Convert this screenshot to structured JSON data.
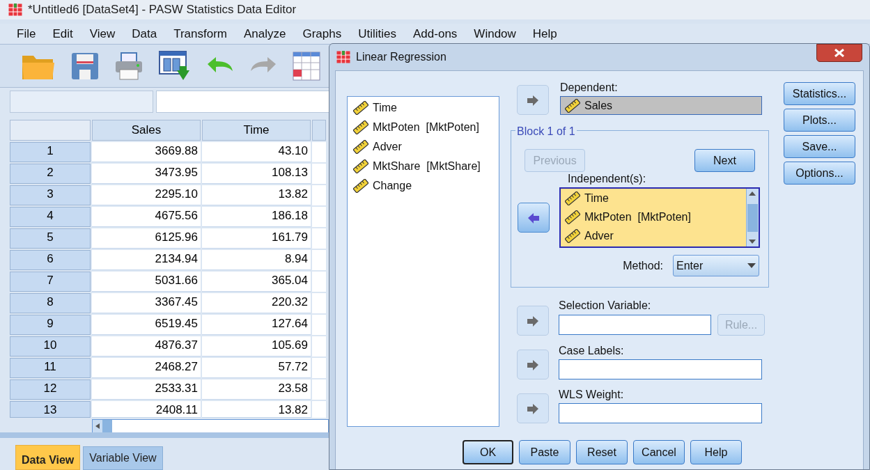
{
  "window": {
    "title": "*Untitled6 [DataSet4] - PASW Statistics Data Editor",
    "menu": [
      "File",
      "Edit",
      "View",
      "Data",
      "Transform",
      "Analyze",
      "Graphs",
      "Utilities",
      "Add-ons",
      "Window",
      "Help"
    ],
    "table": {
      "columns": [
        "Sales",
        "Time"
      ],
      "rows": [
        {
          "row": "1",
          "values": [
            "3669.88",
            "43.10"
          ]
        },
        {
          "row": "2",
          "values": [
            "3473.95",
            "108.13"
          ]
        },
        {
          "row": "3",
          "values": [
            "2295.10",
            "13.82"
          ]
        },
        {
          "row": "4",
          "values": [
            "4675.56",
            "186.18"
          ]
        },
        {
          "row": "5",
          "values": [
            "6125.96",
            "161.79"
          ]
        },
        {
          "row": "6",
          "values": [
            "2134.94",
            "8.94"
          ]
        },
        {
          "row": "7",
          "values": [
            "5031.66",
            "365.04"
          ]
        },
        {
          "row": "8",
          "values": [
            "3367.45",
            "220.32"
          ]
        },
        {
          "row": "9",
          "values": [
            "6519.45",
            "127.64"
          ]
        },
        {
          "row": "10",
          "values": [
            "4876.37",
            "105.69"
          ]
        },
        {
          "row": "11",
          "values": [
            "2468.27",
            "57.72"
          ]
        },
        {
          "row": "12",
          "values": [
            "2533.31",
            "23.58"
          ]
        },
        {
          "row": "13",
          "values": [
            "2408.11",
            "13.82"
          ]
        }
      ]
    },
    "tabs": [
      {
        "label": "Data View",
        "selected": true
      },
      {
        "label": "Variable View",
        "selected": false
      }
    ]
  },
  "dialog": {
    "title": "Linear Regression",
    "variables": [
      "Time",
      "MktPoten  [MktPoten]",
      "Adver",
      "MktShare  [MktShare]",
      "Change"
    ],
    "dependent": {
      "label": "Dependent:",
      "value": "Sales",
      "arrow": {
        "disabled": true,
        "reversed": false
      }
    },
    "block": {
      "title": "Block 1 of 1",
      "previous": {
        "label": "Previous",
        "disabled": true
      },
      "next": {
        "label": "Next",
        "disabled": false
      },
      "independents_label": "Independent(s):",
      "independents": [
        "Time",
        "MktPoten  [MktPoten]",
        "Adver"
      ],
      "arrow": {
        "disabled": false,
        "reversed": true
      },
      "method_label": "Method:",
      "method": "Enter"
    },
    "selection_variable": {
      "label": "Selection Variable:",
      "arrow": {
        "disabled": true,
        "reversed": false
      },
      "rule": {
        "label": "Rule...",
        "disabled": true
      }
    },
    "case_labels": {
      "label": "Case Labels:",
      "arrow": {
        "disabled": true,
        "reversed": false
      }
    },
    "wls_weight": {
      "label": "WLS Weight:",
      "arrow": {
        "disabled": true,
        "reversed": false
      }
    },
    "side_buttons": [
      "Statistics...",
      "Plots...",
      "Save...",
      "Options..."
    ],
    "bottom_buttons": [
      {
        "label": "OK",
        "default": true
      },
      {
        "label": "Paste",
        "default": false
      },
      {
        "label": "Reset",
        "default": false
      },
      {
        "label": "Cancel",
        "default": false
      },
      {
        "label": "Help",
        "default": false
      }
    ]
  }
}
